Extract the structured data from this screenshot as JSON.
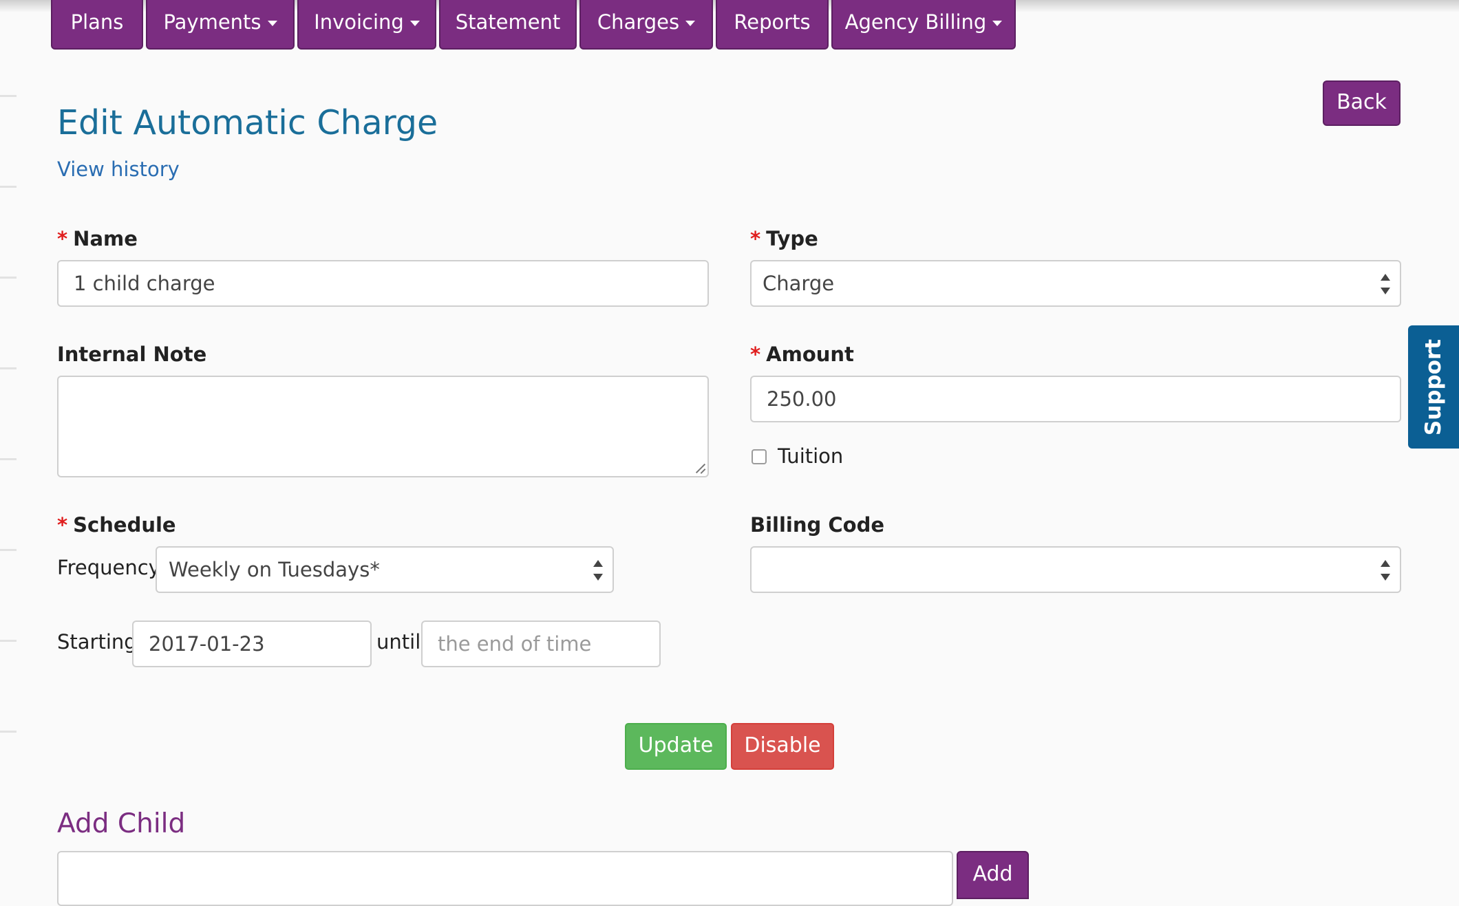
{
  "nav": {
    "tabs": [
      {
        "label": "Plans"
      },
      {
        "label": "Payments"
      },
      {
        "label": "Invoicing"
      },
      {
        "label": "Statement"
      },
      {
        "label": "Charges"
      },
      {
        "label": "Reports"
      },
      {
        "label": "Agency Billing"
      }
    ]
  },
  "page": {
    "title": "Edit Automatic Charge",
    "history_link": "View history",
    "back_label": "Back"
  },
  "form": {
    "required_marker": "*",
    "name": {
      "label": "Name",
      "value": "1 child charge"
    },
    "type": {
      "label": "Type",
      "value": "Charge"
    },
    "internal_note": {
      "label": "Internal Note",
      "value": ""
    },
    "amount": {
      "label": "Amount",
      "value": "250.00"
    },
    "tuition": {
      "label": "Tuition",
      "checked": false
    },
    "schedule": {
      "label": "Schedule",
      "frequency_label": "Frequency",
      "frequency_value": "Weekly on Tuesdays*",
      "starting_label": "Starting",
      "starting_value": "2017-01-23",
      "until_label": "until",
      "until_placeholder": "the end of time"
    },
    "billing_code": {
      "label": "Billing Code",
      "value": ""
    },
    "update_label": "Update",
    "disable_label": "Disable"
  },
  "add_child": {
    "title": "Add Child",
    "input_value": "",
    "add_label": "Add"
  },
  "support": {
    "label": "Support"
  },
  "colors": {
    "brand_purple": "#7b2d81",
    "title_blue": "#1a6e99",
    "support_blue": "#0b5f94",
    "update_green": "#5cb85c",
    "disable_red": "#d9534f",
    "required_red": "#e01e1e"
  }
}
